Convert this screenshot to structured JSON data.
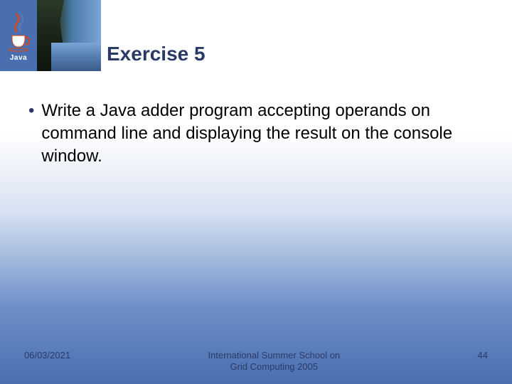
{
  "logo": {
    "text": "Java"
  },
  "title": "Exercise 5",
  "bullets": [
    "Write a Java adder program accepting operands on command line and displaying the result on the console window."
  ],
  "footer": {
    "date": "06/03/2021",
    "venue_line1": "International Summer School on",
    "venue_line2": "Grid Computing 2005",
    "page": "44"
  }
}
